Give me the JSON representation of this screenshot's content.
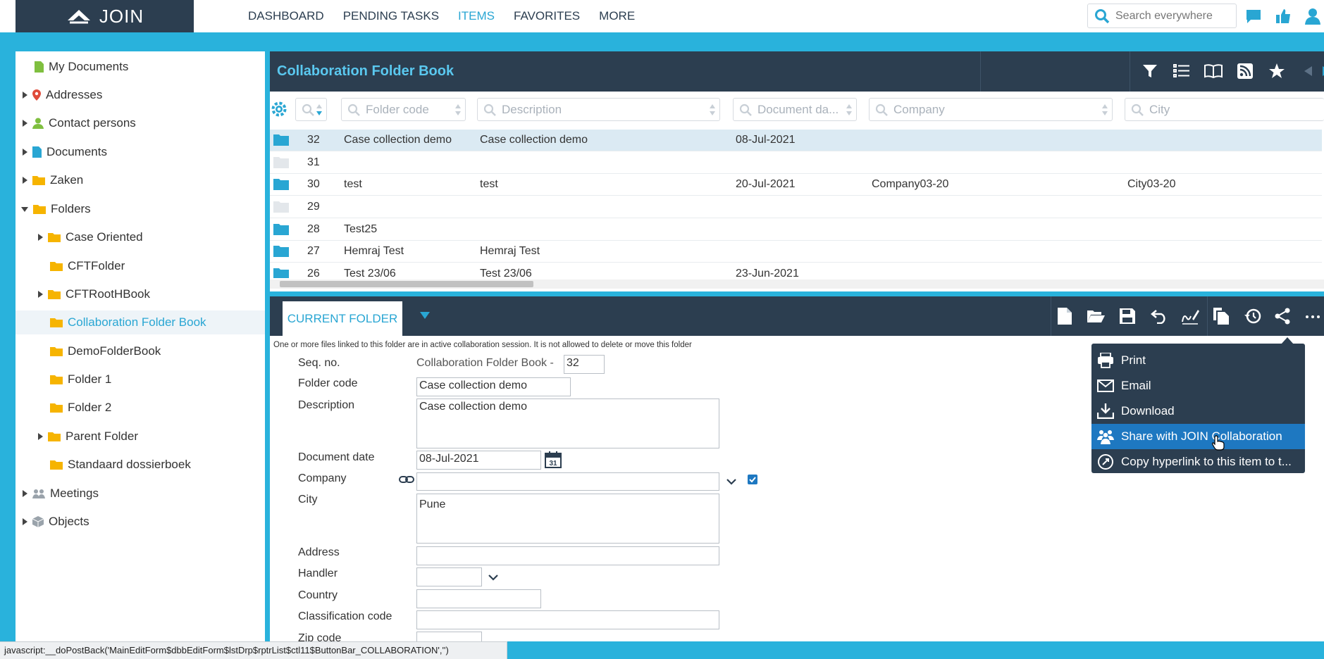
{
  "app": {
    "logo_text": "JOIN"
  },
  "nav": {
    "items": [
      "DASHBOARD",
      "PENDING TASKS",
      "ITEMS",
      "FAVORITES",
      "MORE"
    ],
    "active": "ITEMS"
  },
  "search": {
    "placeholder": "Search everywhere"
  },
  "sidebar": {
    "items": [
      {
        "label": "My Documents",
        "icon": "document-green-icon"
      },
      {
        "label": "Addresses",
        "icon": "map-pin-icon"
      },
      {
        "label": "Contact persons",
        "icon": "person-icon"
      },
      {
        "label": "Documents",
        "icon": "document-blue-icon"
      },
      {
        "label": "Zaken",
        "icon": "folder-icon"
      },
      {
        "label": "Folders",
        "icon": "folder-icon"
      },
      {
        "label": "Case Oriented",
        "icon": "folder-icon"
      },
      {
        "label": "CFTFolder",
        "icon": "folder-icon"
      },
      {
        "label": "CFTRootHBook",
        "icon": "folder-icon"
      },
      {
        "label": "Collaboration Folder Book",
        "icon": "folder-icon",
        "selected": true
      },
      {
        "label": "DemoFolderBook",
        "icon": "folder-icon"
      },
      {
        "label": "Folder 1",
        "icon": "folder-icon"
      },
      {
        "label": "Folder 2",
        "icon": "folder-icon"
      },
      {
        "label": "Parent Folder",
        "icon": "folder-icon"
      },
      {
        "label": "Standaard dossierboek",
        "icon": "folder-icon"
      },
      {
        "label": "Meetings",
        "icon": "people-icon"
      },
      {
        "label": "Objects",
        "icon": "cube-icon"
      }
    ]
  },
  "list": {
    "title": "Collaboration Folder Book",
    "filters": {
      "folder_code": "Folder code",
      "description": "Description",
      "document_date": "Document da...",
      "company": "Company",
      "city": "City"
    },
    "rows": [
      {
        "seq": "32",
        "code": "Case collection demo",
        "desc": "Case collection demo",
        "date": "08-Jul-2021",
        "company": "",
        "city": "",
        "has_files": true
      },
      {
        "seq": "31",
        "code": "",
        "desc": "",
        "date": "",
        "company": "",
        "city": "",
        "has_files": false
      },
      {
        "seq": "30",
        "code": "test",
        "desc": "test",
        "date": "20-Jul-2021",
        "company": "Company03-20",
        "city": "City03-20",
        "has_files": true
      },
      {
        "seq": "29",
        "code": "",
        "desc": "",
        "date": "",
        "company": "",
        "city": "",
        "has_files": false
      },
      {
        "seq": "28",
        "code": "Test25",
        "desc": "",
        "date": "",
        "company": "",
        "city": "",
        "has_files": true
      },
      {
        "seq": "27",
        "code": "Hemraj Test",
        "desc": "Hemraj Test",
        "date": "",
        "company": "",
        "city": "",
        "has_files": true
      },
      {
        "seq": "26",
        "code": "Test 23/06",
        "desc": "Test 23/06",
        "date": "23-Jun-2021",
        "company": "",
        "city": "",
        "has_files": true
      }
    ]
  },
  "detail": {
    "tab_label": "CURRENT FOLDER",
    "notice": "One or more files linked to this folder are in active collaboration session. It is not allowed to delete or move this folder",
    "fields": {
      "seq_label": "Seq. no.",
      "seq_prefix": "Collaboration Folder Book -",
      "seq_value": "32",
      "folder_code_label": "Folder code",
      "folder_code_value": "Case collection demo",
      "description_label": "Description",
      "description_value": "Case collection demo",
      "document_date_label": "Document date",
      "document_date_value": "08-Jul-2021",
      "company_label": "Company",
      "company_value": "",
      "company_checked": true,
      "city_label": "City",
      "city_value": "Pune",
      "address_label": "Address",
      "handler_label": "Handler",
      "country_label": "Country",
      "classification_label": "Classification code",
      "zip_label": "Zip code"
    }
  },
  "share_menu": {
    "items": [
      {
        "label": "Print",
        "icon": "printer-icon"
      },
      {
        "label": "Email",
        "icon": "envelope-icon"
      },
      {
        "label": "Download",
        "icon": "download-icon"
      },
      {
        "label": "Share with JOIN Collaboration",
        "icon": "collaboration-icon",
        "highlighted": true
      },
      {
        "label": "Copy hyperlink to this item to t...",
        "icon": "link-icon"
      }
    ]
  },
  "status_bar": {
    "text": "javascript:__doPostBack('MainEditForm$dbbEditForm$lstDrp$rptrList$ctl11$ButtonBar_COLLABORATION','')"
  },
  "colors": {
    "brand_dark": "#2c3e50",
    "accent": "#29a6d3",
    "background": "#29b2dc",
    "folder": "#f6b400",
    "menu_highlight": "#1e78c1"
  }
}
